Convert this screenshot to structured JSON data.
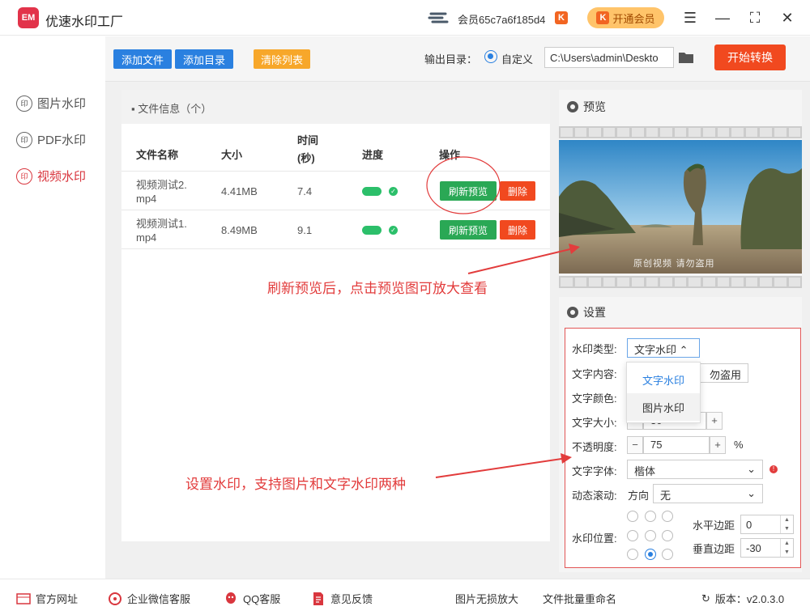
{
  "app": {
    "title": "优速水印工厂",
    "logo_text": "EM"
  },
  "header": {
    "username": "会员65c7a6f185d4",
    "vip_badge": "K",
    "vip_button": "开通会员"
  },
  "sidebar": {
    "items": [
      {
        "label": "图片水印",
        "icon": "印"
      },
      {
        "label": "PDF水印",
        "icon": "印"
      },
      {
        "label": "视频水印",
        "icon": "印"
      }
    ]
  },
  "toolbar": {
    "add_file": "添加文件",
    "add_dir": "添加目录",
    "clear_list": "清除列表",
    "output_label": "输出目录：",
    "custom_label": "自定义",
    "output_path": "C:\\Users\\admin\\Deskto",
    "start": "开始转换"
  },
  "files": {
    "panel_title": "文件信息（个）",
    "columns": {
      "name": "文件名称",
      "size": "大小",
      "time1": "时间",
      "time2": "(秒)",
      "progress": "进度",
      "actions": "操作"
    },
    "rows": [
      {
        "name1": "视频测试2.",
        "name2": "mp4",
        "size": "4.41MB",
        "time": "7.4",
        "progress": 1.0,
        "refresh": "刷新预览",
        "delete": "删除"
      },
      {
        "name1": "视频测试1.",
        "name2": "mp4",
        "size": "8.49MB",
        "time": "9.1",
        "progress": 1.0,
        "refresh": "刷新预览",
        "delete": "删除"
      }
    ]
  },
  "preview": {
    "title": "预览",
    "watermark": "原创视频 请勿盗用"
  },
  "settings": {
    "title": "设置",
    "wm_type_label": "水印类型:",
    "wm_type_value": "文字水印",
    "text_content_label": "文字内容:",
    "text_content_value": "勿盗用",
    "text_color_label": "文字颜色:",
    "text_size_label": "文字大小:",
    "text_size_value": "30",
    "opacity_label": "不透明度:",
    "opacity_value": "75",
    "opacity_unit": "%",
    "font_label": "文字字体:",
    "font_value": "楷体",
    "scroll_label": "动态滚动:",
    "direction_label": "方向",
    "direction_value": "无",
    "position_label": "水印位置:",
    "h_margin_label": "水平边距",
    "h_margin_value": "0",
    "v_margin_label": "垂直边距",
    "v_margin_value": "-30",
    "dropdown_options": [
      "文字水印",
      "图片水印"
    ]
  },
  "annotations": {
    "preview_tip": "刷新预览后，点击预览图可放大查看",
    "settings_tip": "设置水印，支持图片和文字水印两种"
  },
  "footer": {
    "website": "官方网址",
    "wechat": "企业微信客服",
    "qq": "QQ客服",
    "feedback": "意见反馈",
    "enlarge": "图片无损放大",
    "rename": "文件批量重命名",
    "version": "版本：v2.0.3.0"
  },
  "colors": {
    "accent": "#2a80e0",
    "danger": "#f1491f",
    "success": "#2aa855",
    "sidebar_active": "#d9363e"
  }
}
